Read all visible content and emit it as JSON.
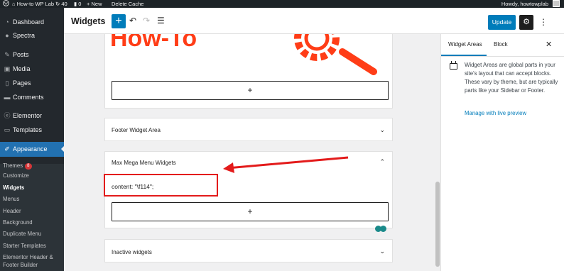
{
  "admin_bar": {
    "site_name": "How-to WP Lab",
    "updates_count": "40",
    "comments_count": "0",
    "new_label": "New",
    "delete_cache_label": "Delete Cache",
    "greeting": "Howdy, howtowplab"
  },
  "sidebar": {
    "items": [
      {
        "label": "Dashboard",
        "icon": "dashboard-icon"
      },
      {
        "label": "Spectra",
        "icon": "spectra-icon"
      },
      {
        "label": "Posts",
        "icon": "pin-icon"
      },
      {
        "label": "Media",
        "icon": "media-icon"
      },
      {
        "label": "Pages",
        "icon": "page-icon"
      },
      {
        "label": "Comments",
        "icon": "comment-icon"
      },
      {
        "label": "Elementor",
        "icon": "elementor-icon"
      },
      {
        "label": "Templates",
        "icon": "folder-icon"
      },
      {
        "label": "Appearance",
        "icon": "brush-icon"
      }
    ],
    "submenu": [
      {
        "label": "Themes",
        "badge": "8"
      },
      {
        "label": "Customize"
      },
      {
        "label": "Widgets"
      },
      {
        "label": "Menus"
      },
      {
        "label": "Header"
      },
      {
        "label": "Background"
      },
      {
        "label": "Duplicate Menu"
      },
      {
        "label": "Starter Templates"
      },
      {
        "label": "Elementor Header &"
      },
      {
        "label": "Footer Builder"
      }
    ]
  },
  "header": {
    "title": "Widgets",
    "update_label": "Update"
  },
  "canvas": {
    "logo_text": "How-To",
    "footer_panel_title": "Footer Widget Area",
    "mega_panel_title": "Max Mega Menu Widgets",
    "code_text": "content: \"\\f114\";",
    "inactive_panel_title": "Inactive widgets"
  },
  "inspector": {
    "tab_widget_areas": "Widget Areas",
    "tab_block": "Block",
    "description": "Widget Areas are global parts in your site's layout that can accept blocks. These vary by theme, but are typically parts like your Sidebar or Footer.",
    "manage_link": "Manage with live preview"
  },
  "colors": {
    "accent": "#007cba",
    "admin_blue": "#2271b1",
    "annotation_red": "#e31b1b",
    "logo_orange": "#ff3d17"
  }
}
